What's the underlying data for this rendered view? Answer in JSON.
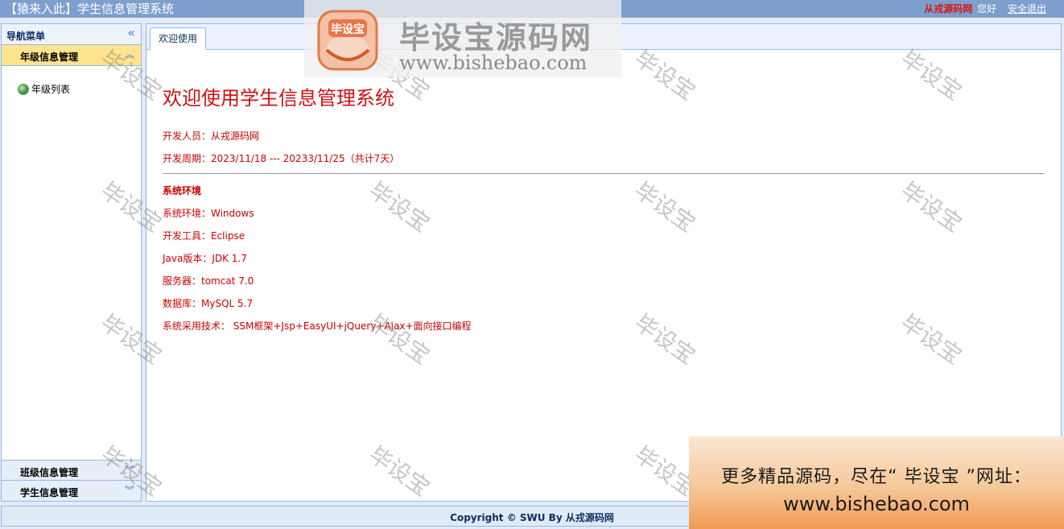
{
  "app": {
    "title": "【猿来入此】学生信息管理系统",
    "user": "从戎源码网",
    "greeting": "您好",
    "logout": "安全退出"
  },
  "sidebar": {
    "header": "导航菜单",
    "collapse_icon": "double-chevron-left-icon",
    "sections": [
      {
        "label": "年级信息管理",
        "expanded": true,
        "items": [
          {
            "label": "年级列表",
            "icon": "globe-icon"
          }
        ]
      },
      {
        "label": "班级信息管理",
        "expanded": false
      },
      {
        "label": "学生信息管理",
        "expanded": false
      }
    ]
  },
  "tabs": [
    {
      "label": "欢迎使用",
      "active": true
    }
  ],
  "welcome": {
    "heading": "欢迎使用学生信息管理系统",
    "developer": "开发人员：从戎源码网",
    "period": "开发周期：2023/11/18 --- 20233/11/25（共计7天）",
    "env_title": "系统环境",
    "lines": [
      "系统环境：Windows",
      "开发工具：Eclipse",
      "Java版本：JDK 1.7",
      "服务器：tomcat 7.0",
      "数据库：MySQL 5.7",
      "系统采用技术： SSM框架+Jsp+EasyUI+jQuery+Ajax+面向接口编程"
    ]
  },
  "footer": {
    "copyright": "Copyright © SWU By 从戎源码网"
  },
  "overlay": {
    "logo_text": "毕设宝源码网",
    "logo_url": "www.bishebao.com",
    "logo_badge": "毕设宝",
    "watermark": "毕设宝",
    "banner_line1": "更多精品源码，尽在“ 毕设宝 ”网址：",
    "banner_line2": "www.bishebao.com"
  },
  "colors": {
    "topbar": "#7d9fcd",
    "accent_red": "#cc0000",
    "active_section": "#ffe48d",
    "border": "#95b8e7"
  }
}
